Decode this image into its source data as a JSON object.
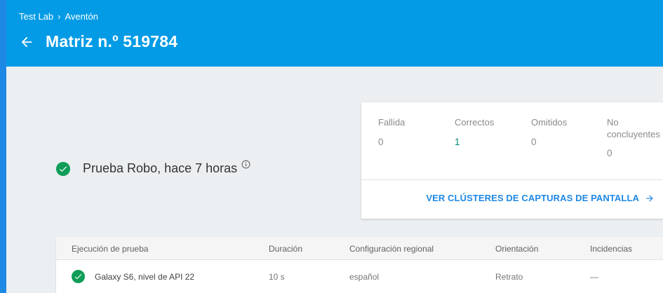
{
  "header": {
    "breadcrumb": [
      "Test Lab",
      "Aventón"
    ],
    "breadcrumb_separator": "›",
    "title": "Matriz n.º 519784"
  },
  "test_status": {
    "text": "Prueba Robo, hace 7 horas",
    "status_color": "#0f9d58"
  },
  "summary": {
    "stats": [
      {
        "label": "Fallida",
        "value": "0"
      },
      {
        "label": "Correctos",
        "value": "1"
      },
      {
        "label": "Omitidos",
        "value": "0"
      },
      {
        "label_line1": "No",
        "label_line2": "concluyentes",
        "value": "0"
      }
    ],
    "link_label": "VER CLÚSTERES DE CAPTURAS DE PANTALLA"
  },
  "table": {
    "columns": [
      "Ejecución de prueba",
      "Duración",
      "Configuración regional",
      "Orientación",
      "Incidencias"
    ],
    "rows": [
      {
        "device": "Galaxy S6, nivel de API 22",
        "duration": "10 s",
        "locale": "español",
        "orientation": "Retrato",
        "issues": "—"
      }
    ]
  },
  "colors": {
    "header_bg": "#039be5",
    "accent": "#1e88e5",
    "passed": "#00897b"
  }
}
